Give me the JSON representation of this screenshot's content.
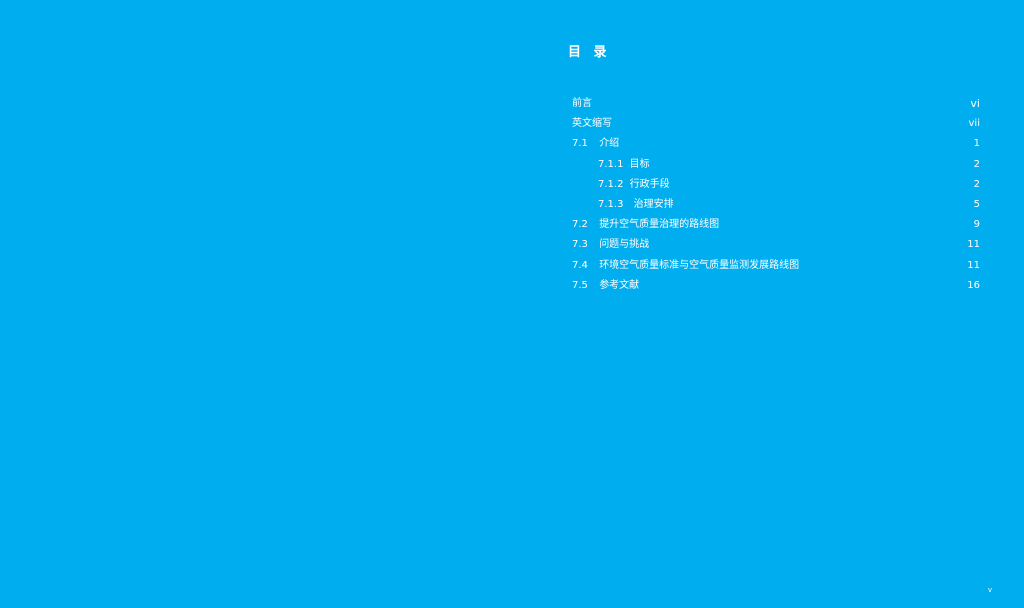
{
  "toc": {
    "title": "目 录",
    "entries": [
      {
        "num": "",
        "label": "前言",
        "page": "vi",
        "level": 1
      },
      {
        "num": "",
        "label": "英文缩写",
        "page": "vii",
        "level": 1
      },
      {
        "num": "7.1",
        "label": "介绍",
        "page": "1",
        "level": 1
      },
      {
        "num": "7.1.1",
        "label": "目标",
        "page": "2",
        "level": 2
      },
      {
        "num": "7.1.2",
        "label": "行政手段",
        "page": "2",
        "level": 2
      },
      {
        "num": "7.1.3",
        "label": "治理安排",
        "page": "5",
        "level": 2
      },
      {
        "num": "7.2",
        "label": "提升空气质量治理的路线图",
        "page": "9",
        "level": 1
      },
      {
        "num": "7.3",
        "label": "问题与挑战",
        "page": "11",
        "level": 1
      },
      {
        "num": "7.4",
        "label": "环境空气质量标准与空气质量监测发展路线图",
        "page": "11",
        "level": 1
      },
      {
        "num": "7.5",
        "label": "参考文献",
        "page": "16",
        "level": 1
      }
    ]
  },
  "page_number": "v",
  "colors": {
    "background": "#00aeef",
    "text": "#ffffff"
  }
}
